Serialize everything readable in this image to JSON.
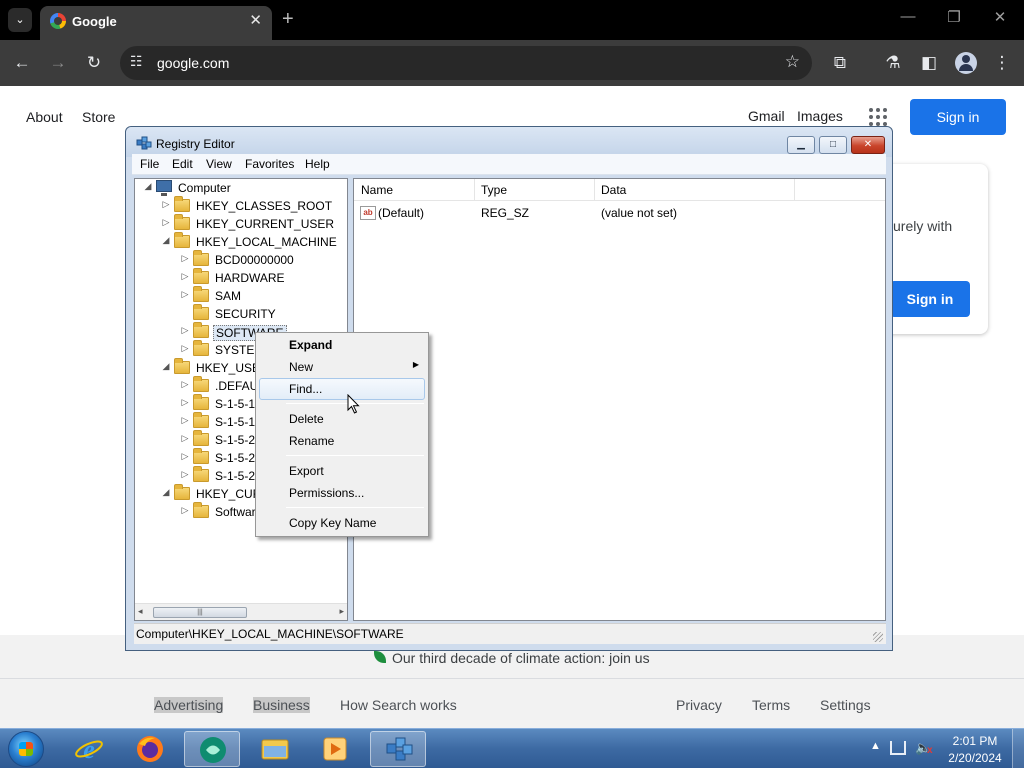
{
  "browser": {
    "tab_title": "Google",
    "url": "google.com",
    "tab_close": "✕",
    "new_tab": "+",
    "window_controls": {
      "minimize": "—",
      "restore": "❐",
      "close": "✕"
    },
    "icons": [
      "back-icon",
      "forward-icon",
      "reload-icon",
      "site-info-icon",
      "star-icon",
      "extensions-icon",
      "labs-icon",
      "side-panel-icon",
      "profile-icon",
      "menu-icon"
    ]
  },
  "google": {
    "nav_left": [
      "About",
      "Store"
    ],
    "nav_right": [
      "Gmail",
      "Images"
    ],
    "sign_in": "Sign in",
    "card_text": "curely with",
    "card_sign_in": "Sign in",
    "climate_text": "Our third decade of climate action: join us",
    "footer_left": [
      "Advertising",
      "Business",
      "How Search works"
    ],
    "footer_right": [
      "Privacy",
      "Terms",
      "Settings"
    ],
    "accent_color": "#1a73e8"
  },
  "regedit": {
    "title": "Registry Editor",
    "caption_buttons": {
      "minimize": "▁",
      "maximize": "□",
      "close": "✕"
    },
    "menu": [
      "File",
      "Edit",
      "View",
      "Favorites",
      "Help"
    ],
    "tree": [
      {
        "label": "Computer",
        "twisty": "◢",
        "icon": "computer"
      },
      {
        "label": "HKEY_CLASSES_ROOT",
        "twisty": "▷",
        "icon": "folder"
      },
      {
        "label": "HKEY_CURRENT_USER",
        "twisty": "▷",
        "icon": "folder"
      },
      {
        "label": "HKEY_LOCAL_MACHINE",
        "twisty": "◢",
        "icon": "folder"
      },
      {
        "label": "BCD00000000",
        "twisty": "▷",
        "icon": "folder"
      },
      {
        "label": "HARDWARE",
        "twisty": "▷",
        "icon": "folder"
      },
      {
        "label": "SAM",
        "twisty": "▷",
        "icon": "folder"
      },
      {
        "label": "SECURITY",
        "twisty": "",
        "icon": "folder"
      },
      {
        "label": "SOFTWARE",
        "twisty": "▷",
        "icon": "folder",
        "selected": true
      },
      {
        "label": "SYSTEM",
        "twisty": "▷",
        "icon": "folder"
      },
      {
        "label": "HKEY_USER",
        "twisty": "◢",
        "icon": "folder"
      },
      {
        "label": ".DEFAU",
        "twisty": "▷",
        "icon": "folder"
      },
      {
        "label": "S-1-5-1",
        "twisty": "▷",
        "icon": "folder"
      },
      {
        "label": "S-1-5-1",
        "twisty": "▷",
        "icon": "folder"
      },
      {
        "label": "S-1-5-2",
        "twisty": "▷",
        "icon": "folder"
      },
      {
        "label": "S-1-5-2",
        "twisty": "▷",
        "icon": "folder"
      },
      {
        "label": "S-1-5-2",
        "twisty": "▷",
        "icon": "folder"
      },
      {
        "label": "HKEY_CUR",
        "twisty": "◢",
        "icon": "folder"
      },
      {
        "label": "Softwar",
        "twisty": "▷",
        "icon": "folder"
      }
    ],
    "columns": [
      "Name",
      "Type",
      "Data"
    ],
    "values": [
      {
        "name": "(Default)",
        "type": "REG_SZ",
        "data": "(value not set)",
        "icon": "ab"
      }
    ],
    "status": "Computer\\HKEY_LOCAL_MACHINE\\SOFTWARE",
    "scroll_left": "◂",
    "scroll_right": "▸",
    "scroll_grip": "|||"
  },
  "context_menu": {
    "items": [
      {
        "label": "Expand",
        "bold": true
      },
      {
        "label": "New",
        "submenu": true
      },
      {
        "label": "Find...",
        "highlighted": true
      },
      {
        "label": "Delete"
      },
      {
        "label": "Rename"
      },
      {
        "label": "Export"
      },
      {
        "label": "Permissions..."
      },
      {
        "label": "Copy Key Name"
      }
    ],
    "submenu_arrow": "▶"
  },
  "taskbar": {
    "apps": [
      "internet-explorer",
      "firefox",
      "chat-app",
      "file-explorer",
      "media-player",
      "registry-editor"
    ],
    "active_app": "registry-editor",
    "time": "2:01 PM",
    "date": "2/20/2024",
    "tray_chevron": "▲",
    "volume_icon": "🔈",
    "volume_mute": "x"
  }
}
